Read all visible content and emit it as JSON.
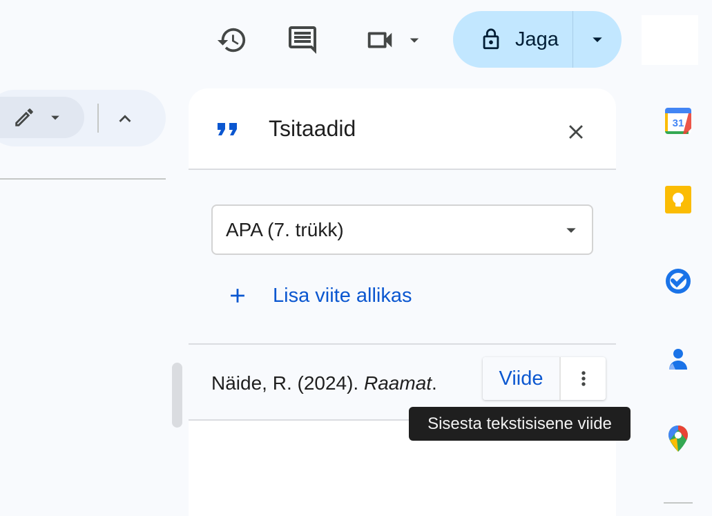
{
  "topbar": {
    "share_label": "Jaga",
    "icons": [
      "history-icon",
      "comments-icon",
      "video-camera-icon",
      "lock-icon"
    ]
  },
  "panel": {
    "title": "Tsitaadid",
    "style_value": "APA (7. trükk)",
    "add_source_label": "Lisa viite allikas",
    "citation": {
      "prefix": "Näide, R. (2024). ",
      "title": "Raamat",
      "suffix": "."
    },
    "cite_button_label": "Viide"
  },
  "tooltip": "Sisesta tekstisisene viide",
  "side_apps": [
    "calendar-icon",
    "keep-icon",
    "tasks-icon",
    "contacts-icon",
    "maps-icon"
  ],
  "calendar_day": "31",
  "colors": {
    "share_bg": "#c2e7ff",
    "accent_blue": "#0b57d0",
    "tooltip_bg": "#1f1f1f",
    "keep_yellow": "#fbbc04"
  }
}
